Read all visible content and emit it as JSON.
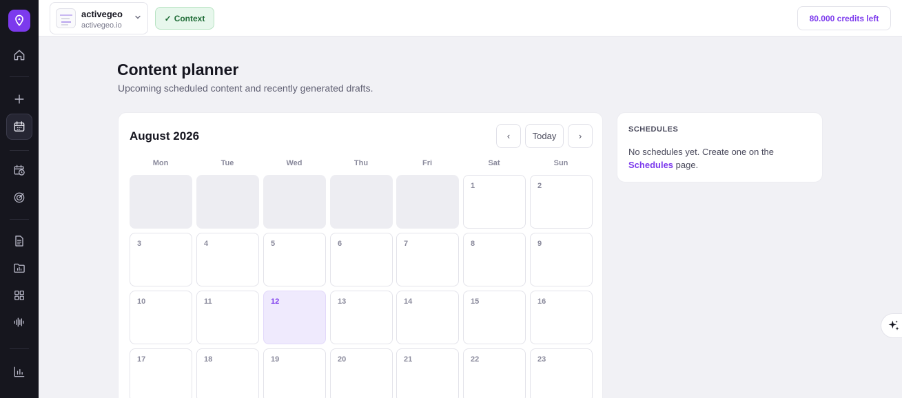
{
  "project": {
    "name": "activegeo",
    "domain": "activegeo.io"
  },
  "context_button": {
    "label": "Context",
    "check": "✓"
  },
  "credits": "80.000 credits left",
  "page": {
    "title": "Content planner",
    "subtitle": "Upcoming scheduled content and recently generated drafts."
  },
  "calendar": {
    "month": "August 2026",
    "nav": {
      "prev": "‹",
      "today": "Today",
      "next": "›"
    },
    "weekdays": [
      "Mon",
      "Tue",
      "Wed",
      "Thu",
      "Fri",
      "Sat",
      "Sun"
    ],
    "weeks": [
      [
        "",
        "",
        "",
        "",
        "",
        "1",
        "2"
      ],
      [
        "3",
        "4",
        "5",
        "6",
        "7",
        "8",
        "9"
      ],
      [
        "10",
        "11",
        "12",
        "13",
        "14",
        "15",
        "16"
      ],
      [
        "17",
        "18",
        "19",
        "20",
        "21",
        "22",
        "23"
      ]
    ],
    "highlighted_day": "12"
  },
  "schedules": {
    "title": "SCHEDULES",
    "text_before": "No schedules yet. Create one on the",
    "link": "Schedules",
    "text_after": " page."
  },
  "sidebar": {
    "icons": [
      "logo-icon",
      "home-icon",
      "plus-icon",
      "calendar-icon",
      "clock-calendar-icon",
      "target-icon",
      "document-icon",
      "folder-chart-icon",
      "grid-icon",
      "audio-wave-icon",
      "bar-chart-icon"
    ],
    "active": "calendar-icon"
  },
  "colors": {
    "accent": "#7c3aed",
    "sidebar": "#16161e",
    "success_bg": "#e7f7ec",
    "success_text": "#1d6b35"
  }
}
